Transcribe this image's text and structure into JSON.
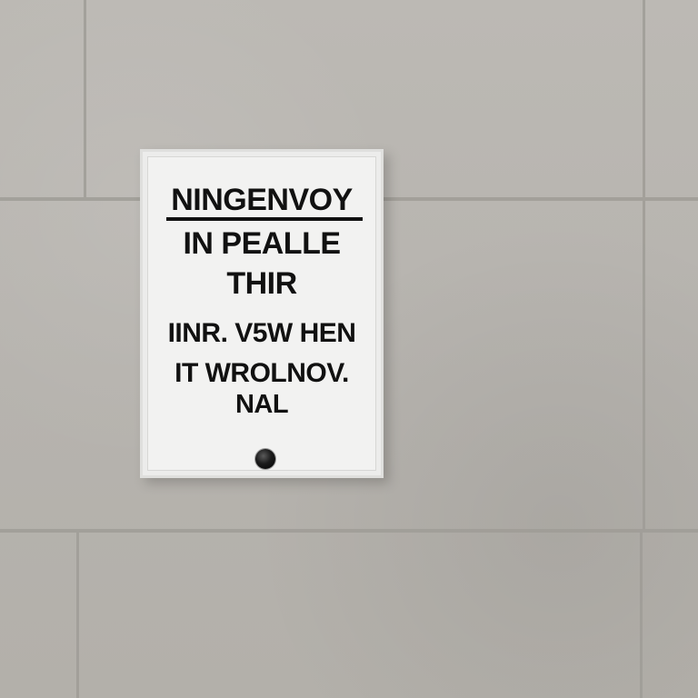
{
  "sign": {
    "lines": [
      "NINGENVOY",
      "IN PEALLE",
      "THIR",
      "IINR. V5W HEN",
      "IT WROLNOV.",
      "NAL"
    ]
  }
}
